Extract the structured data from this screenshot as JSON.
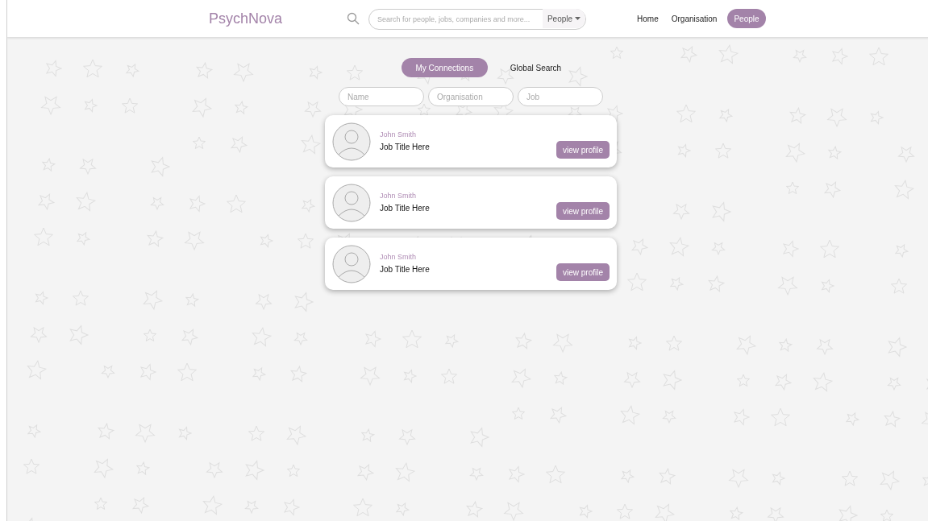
{
  "header": {
    "brand": "PsychNova",
    "search": {
      "placeholder": "Search for people, jobs, companies and more...",
      "scope": "People"
    },
    "nav": [
      {
        "label": "Home",
        "selected": false
      },
      {
        "label": "Organisation",
        "selected": false
      },
      {
        "label": "People",
        "selected": true
      }
    ]
  },
  "tabs": [
    {
      "label": "My Connections",
      "selected": true
    },
    {
      "label": "Global Search",
      "selected": false
    }
  ],
  "filters": [
    {
      "placeholder": "Name"
    },
    {
      "placeholder": "Organisation"
    },
    {
      "placeholder": "Job"
    }
  ],
  "people": [
    {
      "name": "John Smith",
      "job": "Job Title Here",
      "action": "view profile"
    },
    {
      "name": "John Smith",
      "job": "Job Title Here",
      "action": "view profile"
    },
    {
      "name": "John Smith",
      "job": "Job Title Here",
      "action": "view profile"
    }
  ]
}
